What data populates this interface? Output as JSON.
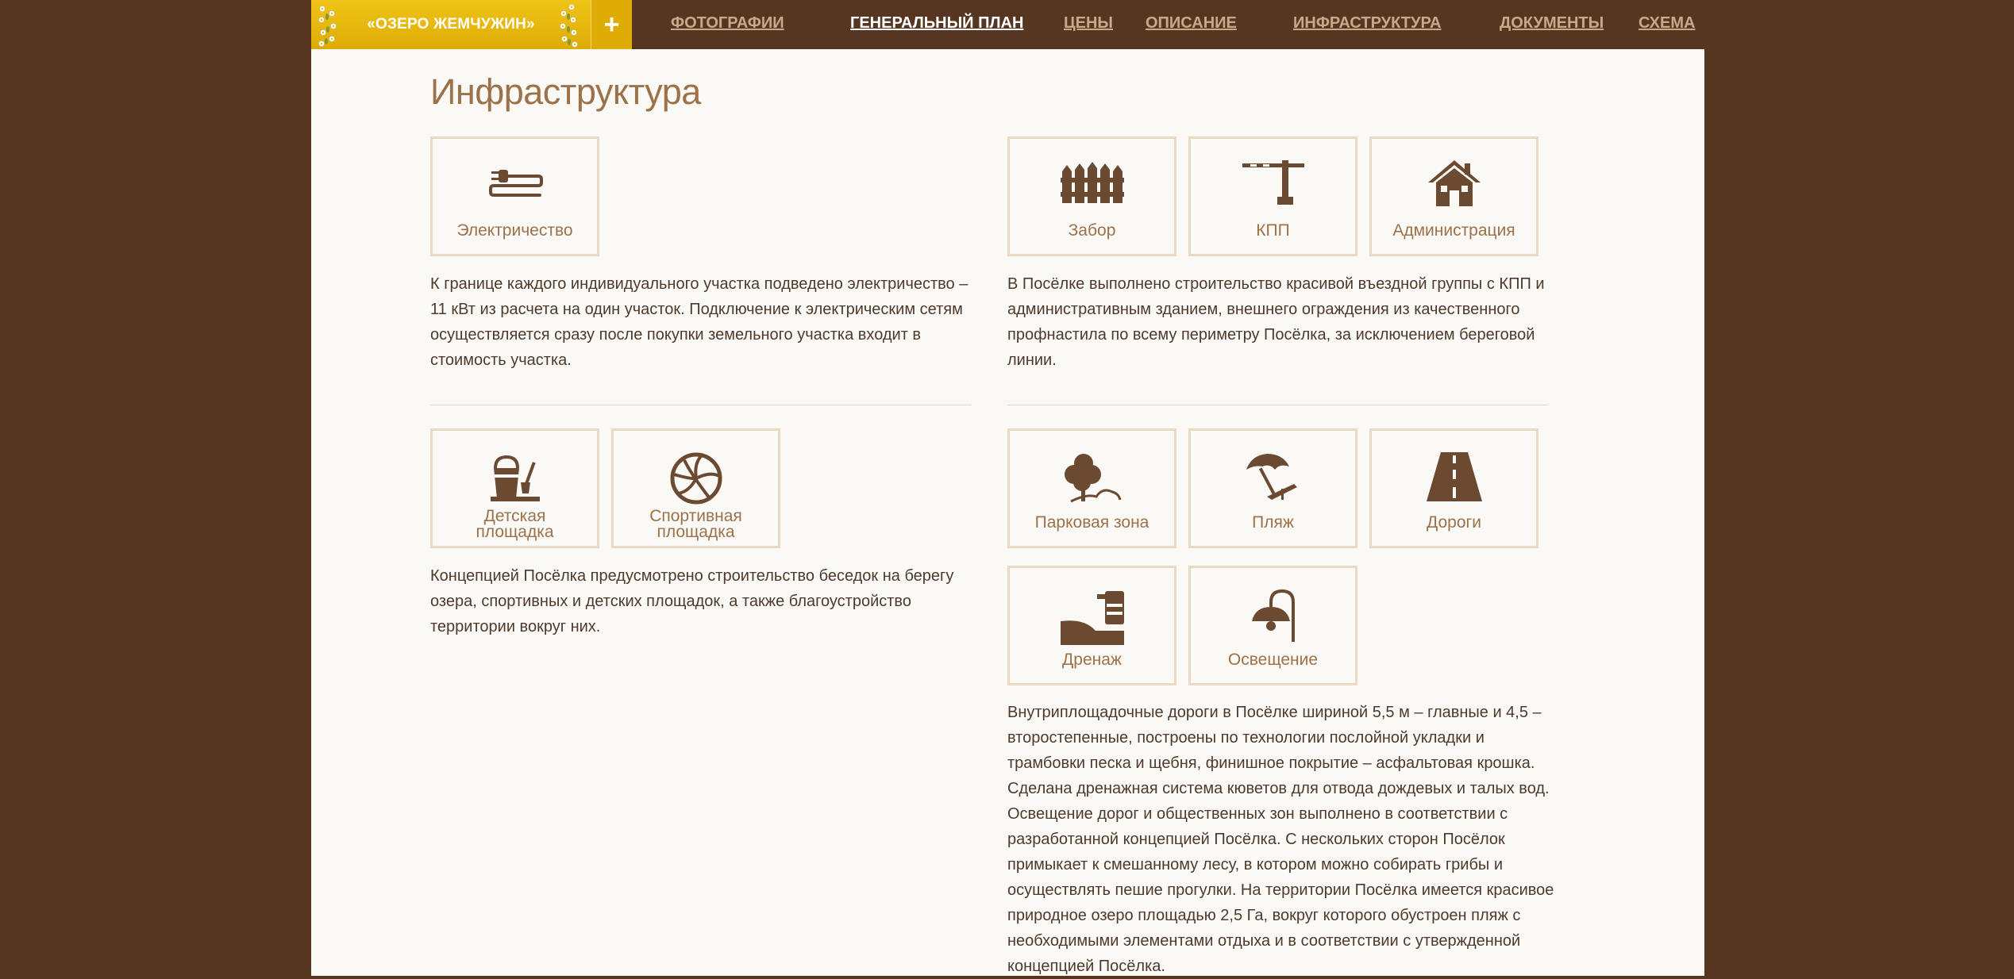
{
  "nav": {
    "logo": "«ОЗЕРО ЖЕМЧУЖИН»",
    "plus": "+",
    "items": [
      {
        "label": "ФОТОГРАФИИ",
        "active": false
      },
      {
        "label": "ГЕНЕРАЛЬНЫЙ ПЛАН",
        "active": true
      },
      {
        "label": "ЦЕНЫ",
        "active": false
      },
      {
        "label": "ОПИСАНИЕ",
        "active": false
      },
      {
        "label": "ИНФРАСТРУКТУРА",
        "active": false
      },
      {
        "label": "ДОКУМЕНТЫ",
        "active": false
      },
      {
        "label": "СХЕМА",
        "active": false
      }
    ]
  },
  "page": {
    "title": "Инфраструктура"
  },
  "sections": {
    "electricity": {
      "tiles": [
        {
          "label": "Электричество",
          "icon": "plug-icon"
        }
      ],
      "text": "К границе каждого индивидуального участка подведено электричество – 11 кВт из расчета на один участок. Подключение к электрическим сетям осуществляется сразу после покупки земельного участка входит в стоимость участка."
    },
    "entrance": {
      "tiles": [
        {
          "label": "Забор",
          "icon": "fence-icon"
        },
        {
          "label": "КПП",
          "icon": "barrier-icon"
        },
        {
          "label": "Администрация",
          "icon": "house-icon"
        }
      ],
      "text": "В Посёлке выполнено строительство красивой въездной группы с КПП и административным зданием, внешнего ограждения из качественного профнастила по всему периметру Посёлка, за исключением береговой линии."
    },
    "playgrounds": {
      "tiles": [
        {
          "label_line1": "Детская",
          "label_line2": "площадка",
          "icon": "sandbox-bucket-icon"
        },
        {
          "label_line1": "Спортивная",
          "label_line2": "площадка",
          "icon": "volleyball-icon"
        }
      ],
      "text": "Концепцией Посёлка предусмотрено строительство беседок на берегу озера, спортивных и детских площадок, а также благоустройство территории вокруг них."
    },
    "territory": {
      "tiles": [
        {
          "label": "Парковая зона",
          "icon": "tree-icon"
        },
        {
          "label": "Пляж",
          "icon": "beach-umbrella-icon"
        },
        {
          "label": "Дороги",
          "icon": "road-icon"
        },
        {
          "label": "Дренаж",
          "icon": "drainage-icon"
        },
        {
          "label": "Освещение",
          "icon": "street-lamp-icon"
        }
      ],
      "text": "Внутриплощадочные дороги в Посёлке шириной 5,5 м – главные и 4,5 – второстепенные, построены по технологии послойной укладки и трамбовки песка и щебня, финишное покрытие – асфальтовая крошка. Сделана дренажная система кюветов для отвода дождевых и талых вод. Освещение дорог и общественных зон выполнено в соответствии с разработанной концепцией Посёлка. С нескольких сторон Посёлок примыкает к смешанному лесу, в котором можно собирать грибы и осуществлять пешие прогулки. На территории Посёлка имеется красивое природное озеро площадью 2,5 Га, вокруг которого обустроен пляж с необходимыми элементами отдыха и в соответствии с утвержденной концепцией Посёлка."
    }
  },
  "colors": {
    "brown": "#563620",
    "gold": "#dfac05",
    "icon": "#6b4a31",
    "accent": "#9b7249"
  }
}
